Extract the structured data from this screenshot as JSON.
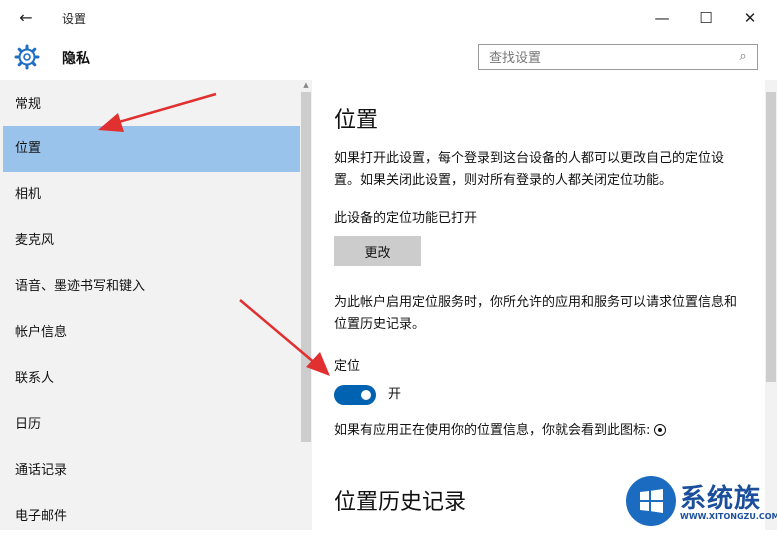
{
  "window": {
    "back_label": "←",
    "title": "设置",
    "minimize": "—",
    "maximize": "☐",
    "close": "✕"
  },
  "header": {
    "icon": "gear-icon",
    "title": "隐私"
  },
  "search": {
    "placeholder": "查找设置",
    "icon": "search-icon"
  },
  "sidebar": {
    "items": [
      {
        "label": "常规",
        "active": false
      },
      {
        "label": "位置",
        "active": true
      },
      {
        "label": "相机",
        "active": false
      },
      {
        "label": "麦克风",
        "active": false
      },
      {
        "label": "语音、墨迹书写和键入",
        "active": false
      },
      {
        "label": "帐户信息",
        "active": false
      },
      {
        "label": "联系人",
        "active": false
      },
      {
        "label": "日历",
        "active": false
      },
      {
        "label": "通话记录",
        "active": false
      },
      {
        "label": "电子邮件",
        "active": false
      }
    ]
  },
  "main": {
    "heading": "位置",
    "description": "如果打开此设置，每个登录到这台设备的人都可以更改自己的定位设置。如果关闭此设置，则对所有登录的人都关闭定位功能。",
    "device_status": "此设备的定位功能已打开",
    "change_button": "更改",
    "account_desc": "为此帐户启用定位服务时，你所允许的应用和服务可以请求位置信息和位置历史记录。",
    "location_label": "定位",
    "toggle_state": "开",
    "toggle_on": true,
    "icon_note": "如果有应用正在使用你的位置信息，你就会看到此图标:",
    "history_heading": "位置历史记录"
  },
  "watermark": {
    "text": "系统族",
    "url": "WWW.XITONGZU.COM"
  },
  "colors": {
    "accent": "#0063b1",
    "selected": "#99c3ea",
    "annotation": "#e03030"
  }
}
